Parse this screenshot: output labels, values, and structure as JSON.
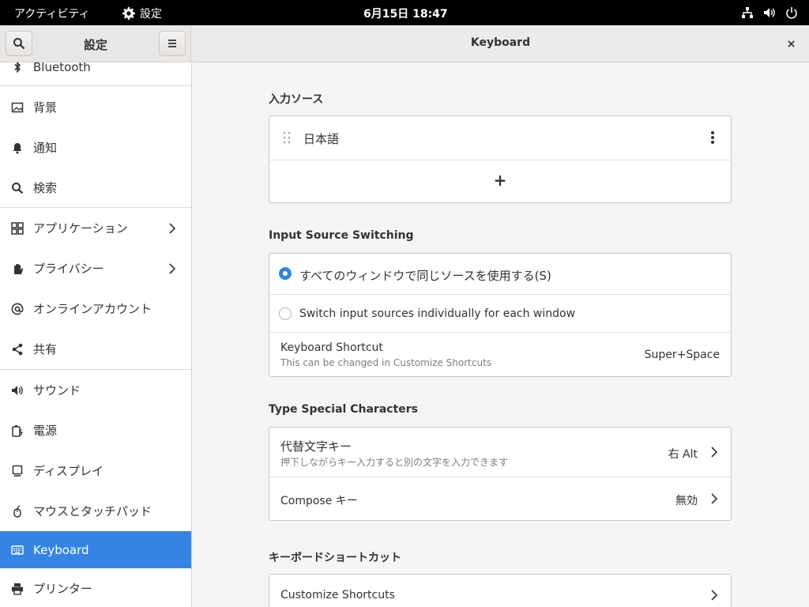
{
  "topbar": {
    "activities": "アクティビティ",
    "app_name": "設定",
    "clock": "6月15日 18:47"
  },
  "header": {
    "sidebar_title": "設定",
    "panel_title": "Keyboard"
  },
  "sidebar": {
    "items": [
      {
        "label": "Bluetooth",
        "icon": "bluetooth-icon"
      },
      {
        "label": "背景",
        "icon": "background-icon"
      },
      {
        "label": "通知",
        "icon": "bell-icon"
      },
      {
        "label": "検索",
        "icon": "search-icon"
      },
      {
        "label": "アプリケーション",
        "icon": "apps-grid-icon"
      },
      {
        "label": "プライバシー",
        "icon": "hand-icon"
      },
      {
        "label": "オンラインアカウント",
        "icon": "at-icon"
      },
      {
        "label": "共有",
        "icon": "share-icon"
      },
      {
        "label": "サウンド",
        "icon": "speaker-icon"
      },
      {
        "label": "電源",
        "icon": "battery-icon"
      },
      {
        "label": "ディスプレイ",
        "icon": "display-icon"
      },
      {
        "label": "マウスとタッチパッド",
        "icon": "mouse-icon"
      },
      {
        "label": "Keyboard",
        "icon": "keyboard-icon"
      },
      {
        "label": "プリンター",
        "icon": "printer-icon"
      }
    ],
    "active": "Keyboard"
  },
  "input_sources": {
    "title": "入力ソース",
    "source_name": "日本語",
    "add_symbol": "+"
  },
  "switching": {
    "title": "Input Source Switching",
    "option_same": "すべてのウィンドウで同じソースを使用する(S)",
    "option_individual": "Switch input sources individually for each window",
    "selected": "option_same",
    "shortcut_label": "Keyboard Shortcut",
    "shortcut_sub": "This can be changed in Customize Shortcuts",
    "shortcut_value": "Super+Space"
  },
  "special": {
    "title": "Type Special Characters",
    "alt_label": "代替文字キー",
    "alt_sub": "押下しながらキー入力すると別の文字を入力できます",
    "alt_value": "右 Alt",
    "compose_label": "Compose キー",
    "compose_value": "無効"
  },
  "shortcuts": {
    "title": "キーボードショートカット",
    "customize_label": "Customize Shortcuts"
  },
  "colors": {
    "accent": "#3584e4",
    "topbar": "#000000"
  }
}
